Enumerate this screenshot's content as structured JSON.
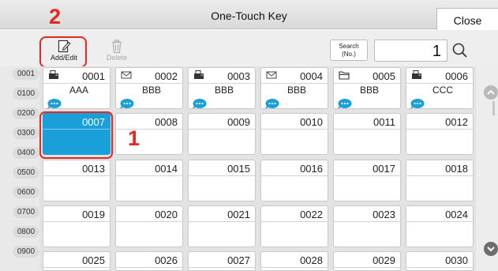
{
  "header": {
    "title": "One-Touch Key",
    "close_label": "Close"
  },
  "toolbar": {
    "add_edit_label": "Add/Edit",
    "delete_label": "Delete"
  },
  "search": {
    "button_line1": "Search",
    "button_line2": "(No.)",
    "value": "1"
  },
  "callouts": {
    "step1": "1",
    "step2": "2"
  },
  "index_buttons": [
    "0001",
    "0100",
    "0200",
    "0300",
    "0400",
    "0500",
    "0600",
    "0700",
    "0800",
    "0900"
  ],
  "keys": [
    {
      "num": "0001",
      "name": "AAA",
      "type": "fax"
    },
    {
      "num": "0002",
      "name": "BBB",
      "type": "email"
    },
    {
      "num": "0003",
      "name": "BBB",
      "type": "fax"
    },
    {
      "num": "0004",
      "name": "BBB",
      "type": "email"
    },
    {
      "num": "0005",
      "name": "BBB",
      "type": "folder"
    },
    {
      "num": "0006",
      "name": "CCC",
      "type": "fax"
    },
    {
      "num": "0007",
      "name": "",
      "type": "",
      "selected": true
    },
    {
      "num": "0008",
      "name": "",
      "type": ""
    },
    {
      "num": "0009",
      "name": "",
      "type": ""
    },
    {
      "num": "0010",
      "name": "",
      "type": ""
    },
    {
      "num": "0011",
      "name": "",
      "type": ""
    },
    {
      "num": "0012",
      "name": "",
      "type": ""
    },
    {
      "num": "0013",
      "name": "",
      "type": ""
    },
    {
      "num": "0014",
      "name": "",
      "type": ""
    },
    {
      "num": "0015",
      "name": "",
      "type": ""
    },
    {
      "num": "0016",
      "name": "",
      "type": ""
    },
    {
      "num": "0017",
      "name": "",
      "type": ""
    },
    {
      "num": "0018",
      "name": "",
      "type": ""
    },
    {
      "num": "0019",
      "name": "",
      "type": ""
    },
    {
      "num": "0020",
      "name": "",
      "type": ""
    },
    {
      "num": "0021",
      "name": "",
      "type": ""
    },
    {
      "num": "0022",
      "name": "",
      "type": ""
    },
    {
      "num": "0023",
      "name": "",
      "type": ""
    },
    {
      "num": "0024",
      "name": "",
      "type": ""
    },
    {
      "num": "0025",
      "name": "",
      "type": ""
    },
    {
      "num": "0026",
      "name": "",
      "type": ""
    },
    {
      "num": "0027",
      "name": "",
      "type": ""
    },
    {
      "num": "0028",
      "name": "",
      "type": ""
    },
    {
      "num": "0029",
      "name": "",
      "type": ""
    },
    {
      "num": "0030",
      "name": "",
      "type": ""
    }
  ],
  "icons": {
    "fax": "fax-icon",
    "email": "email-icon",
    "folder": "folder-icon",
    "bubble": "speech-bubble-icon",
    "add_edit": "edit-icon",
    "delete": "trash-icon",
    "search": "search-icon"
  },
  "colors": {
    "selected": "#1b9fd9",
    "callout": "#e8251f",
    "bubble": "#1b9fd9"
  }
}
